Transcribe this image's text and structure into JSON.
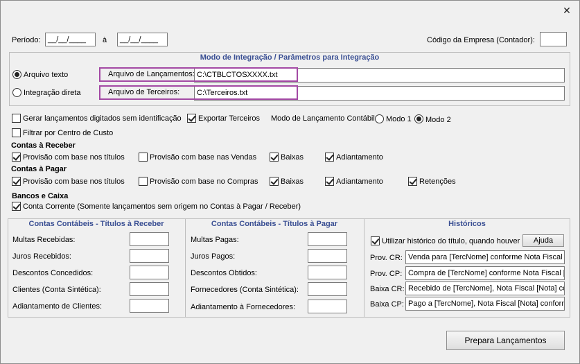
{
  "header": {
    "periodo_label": "Período:",
    "periodo_inicio": "__/__/____",
    "a_label": "à",
    "periodo_fim": "__/__/____",
    "codigo_empresa_label": "Código da Empresa (Contador):",
    "codigo_empresa_value": "",
    "close_glyph": "✕"
  },
  "integracao": {
    "title": "Modo de Integração / Parâmetros para Integração",
    "arquivo_texto_label": "Arquivo texto",
    "integracao_direta_label": "Integração direta",
    "arquivo_lancamentos_label": "Arquivo de Lançamentos:",
    "arquivo_lancamentos_value": "C:\\CTBLCTOSXXXX.txt",
    "arquivo_terceiros_label": "Arquivo de Terceiros:",
    "arquivo_terceiros_value": "C:\\Terceiros.txt",
    "selected_mode": "arquivo_texto"
  },
  "opcoes": {
    "gerar_lancamentos_label": "Gerar lançamentos digitados sem identificação",
    "gerar_lancamentos_checked": false,
    "exportar_terceiros_label": "Exportar Terceiros",
    "exportar_terceiros_checked": true,
    "modo_lancamento_label": "Modo de Lançamento Contábil:",
    "modo1_label": "Modo 1",
    "modo2_label": "Modo 2",
    "modo_selected": 2,
    "filtrar_centro_label": "Filtrar por Centro de Custo",
    "filtrar_centro_checked": false
  },
  "contas_receber": {
    "title": "Contas à Receber",
    "provisao_titulos_label": "Provisão com base nos títulos",
    "provisao_titulos_checked": true,
    "provisao_vendas_label": "Provisão com base nas Vendas",
    "provisao_vendas_checked": false,
    "baixas_label": "Baixas",
    "baixas_checked": true,
    "adiantamento_label": "Adiantamento",
    "adiantamento_checked": true
  },
  "contas_pagar": {
    "title": "Contas à Pagar",
    "provisao_titulos_label": "Provisão com base nos títulos",
    "provisao_titulos_checked": true,
    "provisao_compras_label": "Provisão com base no Compras",
    "provisao_compras_checked": false,
    "baixas_label": "Baixas",
    "baixas_checked": true,
    "adiantamento_label": "Adiantamento",
    "adiantamento_checked": true,
    "retencoes_label": "Retenções",
    "retencoes_checked": true
  },
  "bancos": {
    "title": "Bancos e Caixa",
    "conta_corrente_label": "Conta Corrente (Somente lançamentos sem origem no Contas à Pagar / Receber)",
    "conta_corrente_checked": true
  },
  "titulos_receber": {
    "title": "Contas Contábeis - Títulos à Receber",
    "fields": [
      {
        "label": "Multas Recebidas:",
        "value": ""
      },
      {
        "label": "Juros Recebidos:",
        "value": ""
      },
      {
        "label": "Descontos Concedidos:",
        "value": ""
      },
      {
        "label": "Clientes (Conta Sintética):",
        "value": ""
      },
      {
        "label": "Adiantamento de Clientes:",
        "value": ""
      }
    ]
  },
  "titulos_pagar": {
    "title": "Contas Contábeis - Títulos à Pagar",
    "fields": [
      {
        "label": "Multas Pagas:",
        "value": ""
      },
      {
        "label": "Juros Pagos:",
        "value": ""
      },
      {
        "label": "Descontos Obtidos:",
        "value": ""
      },
      {
        "label": "Fornecedores (Conta Sintética):",
        "value": ""
      },
      {
        "label": "Adiantamento à Fornecedores:",
        "value": ""
      }
    ]
  },
  "historicos": {
    "title": "Históricos",
    "utilizar_label": "Utilizar histórico do título, quando houver",
    "utilizar_checked": true,
    "ajuda_label": "Ajuda",
    "fields": [
      {
        "label": "Prov. CR:",
        "value": "Venda para [TercNome] conforme Nota Fiscal [N"
      },
      {
        "label": "Prov. CP:",
        "value": "Compra de [TercNome] conforme Nota Fiscal [N"
      },
      {
        "label": "Baixa CR:",
        "value": "Recebido de [TercNome], Nota Fiscal [Nota] co"
      },
      {
        "label": "Baixa CP:",
        "value": "Pago a [TercNome], Nota Fiscal [Nota] conform"
      }
    ]
  },
  "footer": {
    "prepara_label": "Prepara Lançamentos"
  }
}
